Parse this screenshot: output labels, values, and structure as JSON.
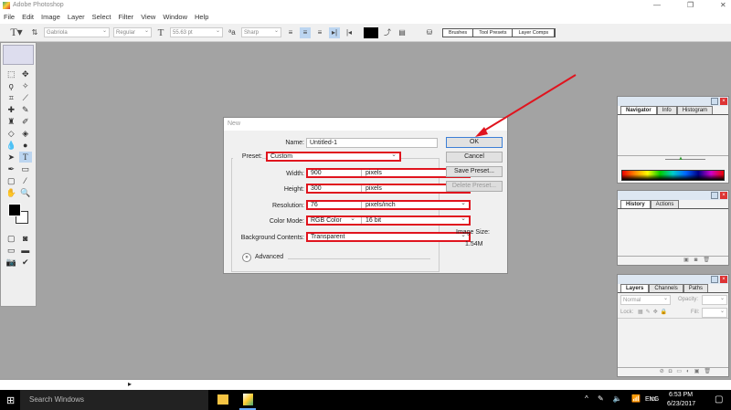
{
  "app": {
    "title": "Adobe Photoshop"
  },
  "menu": [
    "File",
    "Edit",
    "Image",
    "Layer",
    "Select",
    "Filter",
    "View",
    "Window",
    "Help"
  ],
  "options": {
    "font_family": "Gabriola",
    "font_style": "Regular",
    "font_size": "55.63 pt",
    "antialias": "Sharp",
    "tabs": [
      "Brushes",
      "Tool Presets",
      "Layer Comps"
    ]
  },
  "dialog": {
    "title": "New",
    "name_label": "Name:",
    "name_value": "Untitled-1",
    "preset_label": "Preset:",
    "preset_value": "Custom",
    "width_label": "Width:",
    "width_value": "900",
    "width_unit": "pixels",
    "height_label": "Height:",
    "height_value": "300",
    "height_unit": "pixels",
    "resolution_label": "Resolution:",
    "resolution_value": "76",
    "resolution_unit": "pixels/inch",
    "colormode_label": "Color Mode:",
    "colormode_value": "RGB Color",
    "bitdepth_value": "16 bit",
    "bg_label": "Background Contents:",
    "bg_value": "Transparent",
    "advanced_label": "Advanced",
    "image_size_label": "Image Size:",
    "image_size_value": "1.54M",
    "ok": "OK",
    "cancel": "Cancel",
    "save_preset": "Save Preset...",
    "delete_preset": "Delete Preset..."
  },
  "panels": {
    "navigator_tabs": [
      "Navigator",
      "Info",
      "Histogram"
    ],
    "history_tabs": [
      "History",
      "Actions"
    ],
    "layers_tabs": [
      "Layers",
      "Channels",
      "Paths"
    ],
    "blend_mode": "Normal",
    "opacity_label": "Opacity:",
    "lock_label": "Lock:",
    "fill_label": "Fill:"
  },
  "taskbar": {
    "search": "Search Windows",
    "lang": "ENG",
    "time": "6:53 PM",
    "date": "6/23/2017"
  },
  "colors": {
    "highlight": "#e0141e",
    "arrow": "#e0141e"
  }
}
